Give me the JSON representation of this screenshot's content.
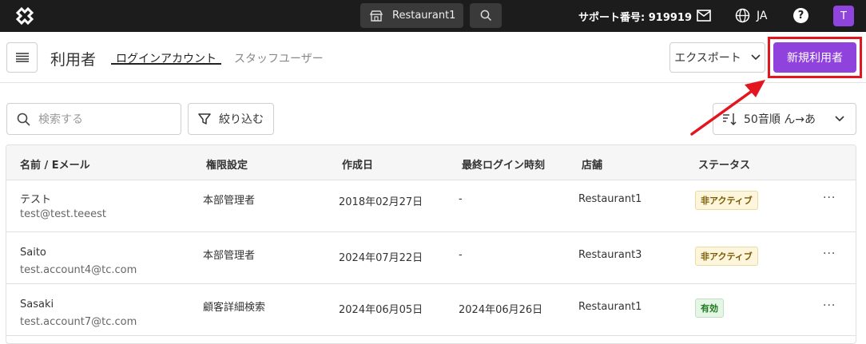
{
  "topbar": {
    "store_name": "Restaurant1",
    "support_text": "サポート番号: 919919",
    "language": "JA",
    "help_glyph": "?",
    "avatar_initial": "T"
  },
  "subheader": {
    "page_title": "利用者",
    "tabs": [
      {
        "label": "ログインアカウント",
        "active": true
      },
      {
        "label": "スタッフユーザー",
        "active": false
      }
    ],
    "export_label": "エクスポート",
    "new_user_label": "新規利用者"
  },
  "toolbar": {
    "search_placeholder": "検索する",
    "filter_label": "絞り込む",
    "sort_label": "50音順 ん→あ"
  },
  "table": {
    "columns": [
      "名前 / Eメール",
      "権限設定",
      "作成日",
      "最終ログイン時刻",
      "店舗",
      "ステータス"
    ],
    "rows": [
      {
        "name": "テスト",
        "email": "test@test.teeest",
        "role": "本部管理者",
        "created": "2018年02月27日",
        "last_login": "-",
        "store": "Restaurant1",
        "status": "非アクティブ"
      },
      {
        "name": "Saito",
        "email": "test.account4@tc.com",
        "role": "本部管理者",
        "created": "2024年07月22日",
        "last_login": "-",
        "store": "Restaurant3",
        "status": "非アクティブ"
      },
      {
        "name": "Sasaki",
        "email": "test.account7@tc.com",
        "role": "顧客詳細検索",
        "created": "2024年06月05日",
        "last_login": "2024年06月26日",
        "store": "Restaurant1",
        "status": "有効"
      }
    ],
    "more_glyph": "···"
  },
  "colors": {
    "topbar_bg": "#1c1c1c",
    "accent_purple": "#8f43dc",
    "highlight_red": "#e3161f"
  },
  "icons": [
    "logo-icon",
    "store-icon",
    "search-icon",
    "mail-icon",
    "globe-icon",
    "help-icon",
    "menu-icon",
    "chevron-down-icon",
    "filter-icon",
    "sort-icon",
    "more-icon"
  ]
}
